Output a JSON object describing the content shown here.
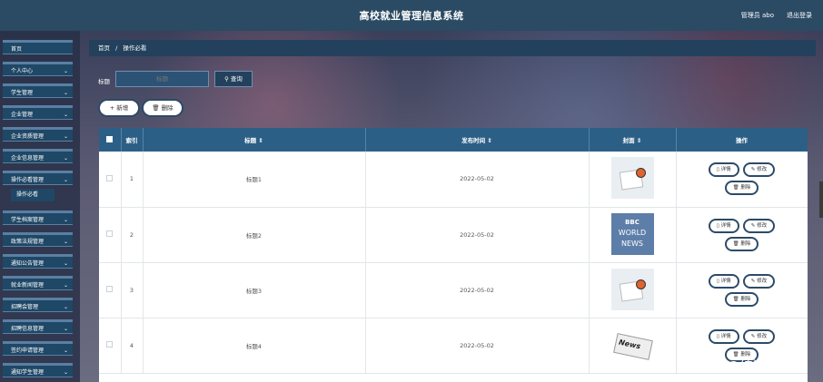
{
  "header": {
    "title": "高校就业管理信息系统",
    "user_label": "管理员 abo",
    "logout_label": "退出登录"
  },
  "sidebar": {
    "items": [
      {
        "label": "首页",
        "has_chevron": false
      },
      {
        "label": "个人中心",
        "has_chevron": true
      },
      {
        "label": "学生管理",
        "has_chevron": true
      },
      {
        "label": "企业管理",
        "has_chevron": true
      },
      {
        "label": "企业资质管理",
        "has_chevron": true
      },
      {
        "label": "企业信息管理",
        "has_chevron": true
      },
      {
        "label": "操作必看管理",
        "has_chevron": true
      },
      {
        "label": "学生档案管理",
        "has_chevron": true
      },
      {
        "label": "政策法规管理",
        "has_chevron": true
      },
      {
        "label": "通知公告管理",
        "has_chevron": true
      },
      {
        "label": "就业新闻管理",
        "has_chevron": true
      },
      {
        "label": "招聘会管理",
        "has_chevron": true
      },
      {
        "label": "招聘信息管理",
        "has_chevron": true
      },
      {
        "label": "签约申请管理",
        "has_chevron": true
      },
      {
        "label": "通知学生管理",
        "has_chevron": true
      }
    ],
    "active_submenu": "操作必看",
    "chevron": "⌄"
  },
  "breadcrumb": {
    "home": "首页",
    "separator": "/",
    "current": "操作必看"
  },
  "search": {
    "label": "标题",
    "placeholder": "标题",
    "button_label": "查询",
    "button_icon": "search-icon"
  },
  "toolbar": {
    "add_label": "+ 新增",
    "delete_label": "删除",
    "delete_icon": "trash-icon"
  },
  "table": {
    "columns": [
      "",
      "索引",
      "标题 ⇕",
      "发布时间 ⇕",
      "封面 ⇕",
      "操作"
    ],
    "rows": [
      {
        "index": "1",
        "title": "标题1",
        "date": "2022-05-02",
        "cover": "news-icon"
      },
      {
        "index": "2",
        "title": "标题2",
        "date": "2022-05-02",
        "cover": "bbc-world-news"
      },
      {
        "index": "3",
        "title": "标题3",
        "date": "2022-05-02",
        "cover": "news-icon"
      },
      {
        "index": "4",
        "title": "标题4",
        "date": "2022-05-02",
        "cover": "news-paper"
      }
    ],
    "bbc_cover": {
      "line1": "BBC",
      "line2": "WORLD",
      "line3": "NEWS"
    },
    "paper_cover_text": "News",
    "actions": {
      "detail": "详情",
      "edit": "修改",
      "delete": "删除"
    }
  },
  "watermark": "CSDN @纯清科技",
  "colors": {
    "header_bg": "#2b4a63",
    "table_header_bg": "#2c5f86",
    "sidebar_item_bg": "#1f4766"
  }
}
